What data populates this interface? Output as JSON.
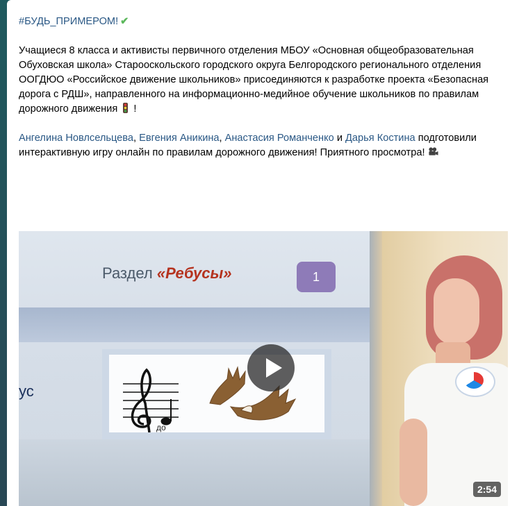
{
  "post": {
    "hashtag": "#БУДЬ_ПРИМЕРОМ!",
    "check_icon": "heavy-check-mark-icon",
    "paragraph1": "Учащиеся 8 класса и активисты первичного отделения МБОУ «Основная общеобразовательная Обуховская школа» Старооскольского городского округа Белгородского регионального отделения ООГДЮО «Российское движение школьников» присоединяются к разработке проекта «Безопасная дорога с РДШ», направленного на информационно-медийное обучение школьников по правилам дорожного движения",
    "paragraph1_end": " !",
    "traffic_icon": "traffic-light-icon",
    "mentions": [
      "Ангелина Новлсельцева",
      "Евгения Аникина",
      "Анастасия Романченко",
      "Дарья Костина"
    ],
    "sep_comma": ", ",
    "sep_and": " и ",
    "paragraph2_rest": " подготовили интерактивную игру онлайн по правилам дорожного движения! Приятного просмотра! ",
    "camera_icon": "video-camera-icon"
  },
  "video": {
    "slide_title_prefix": "Раздел ",
    "slide_title_highlight": "«Ребусы»",
    "slide_number": "1",
    "slide_side_text": "ус",
    "rebus_note_label": "до",
    "duration": "2:54",
    "play_icon": "play-icon"
  },
  "colors": {
    "link": "#2a5885",
    "check": "#5cb85c",
    "badge": "#8e7bb8",
    "slide_accent": "#b5331f"
  }
}
